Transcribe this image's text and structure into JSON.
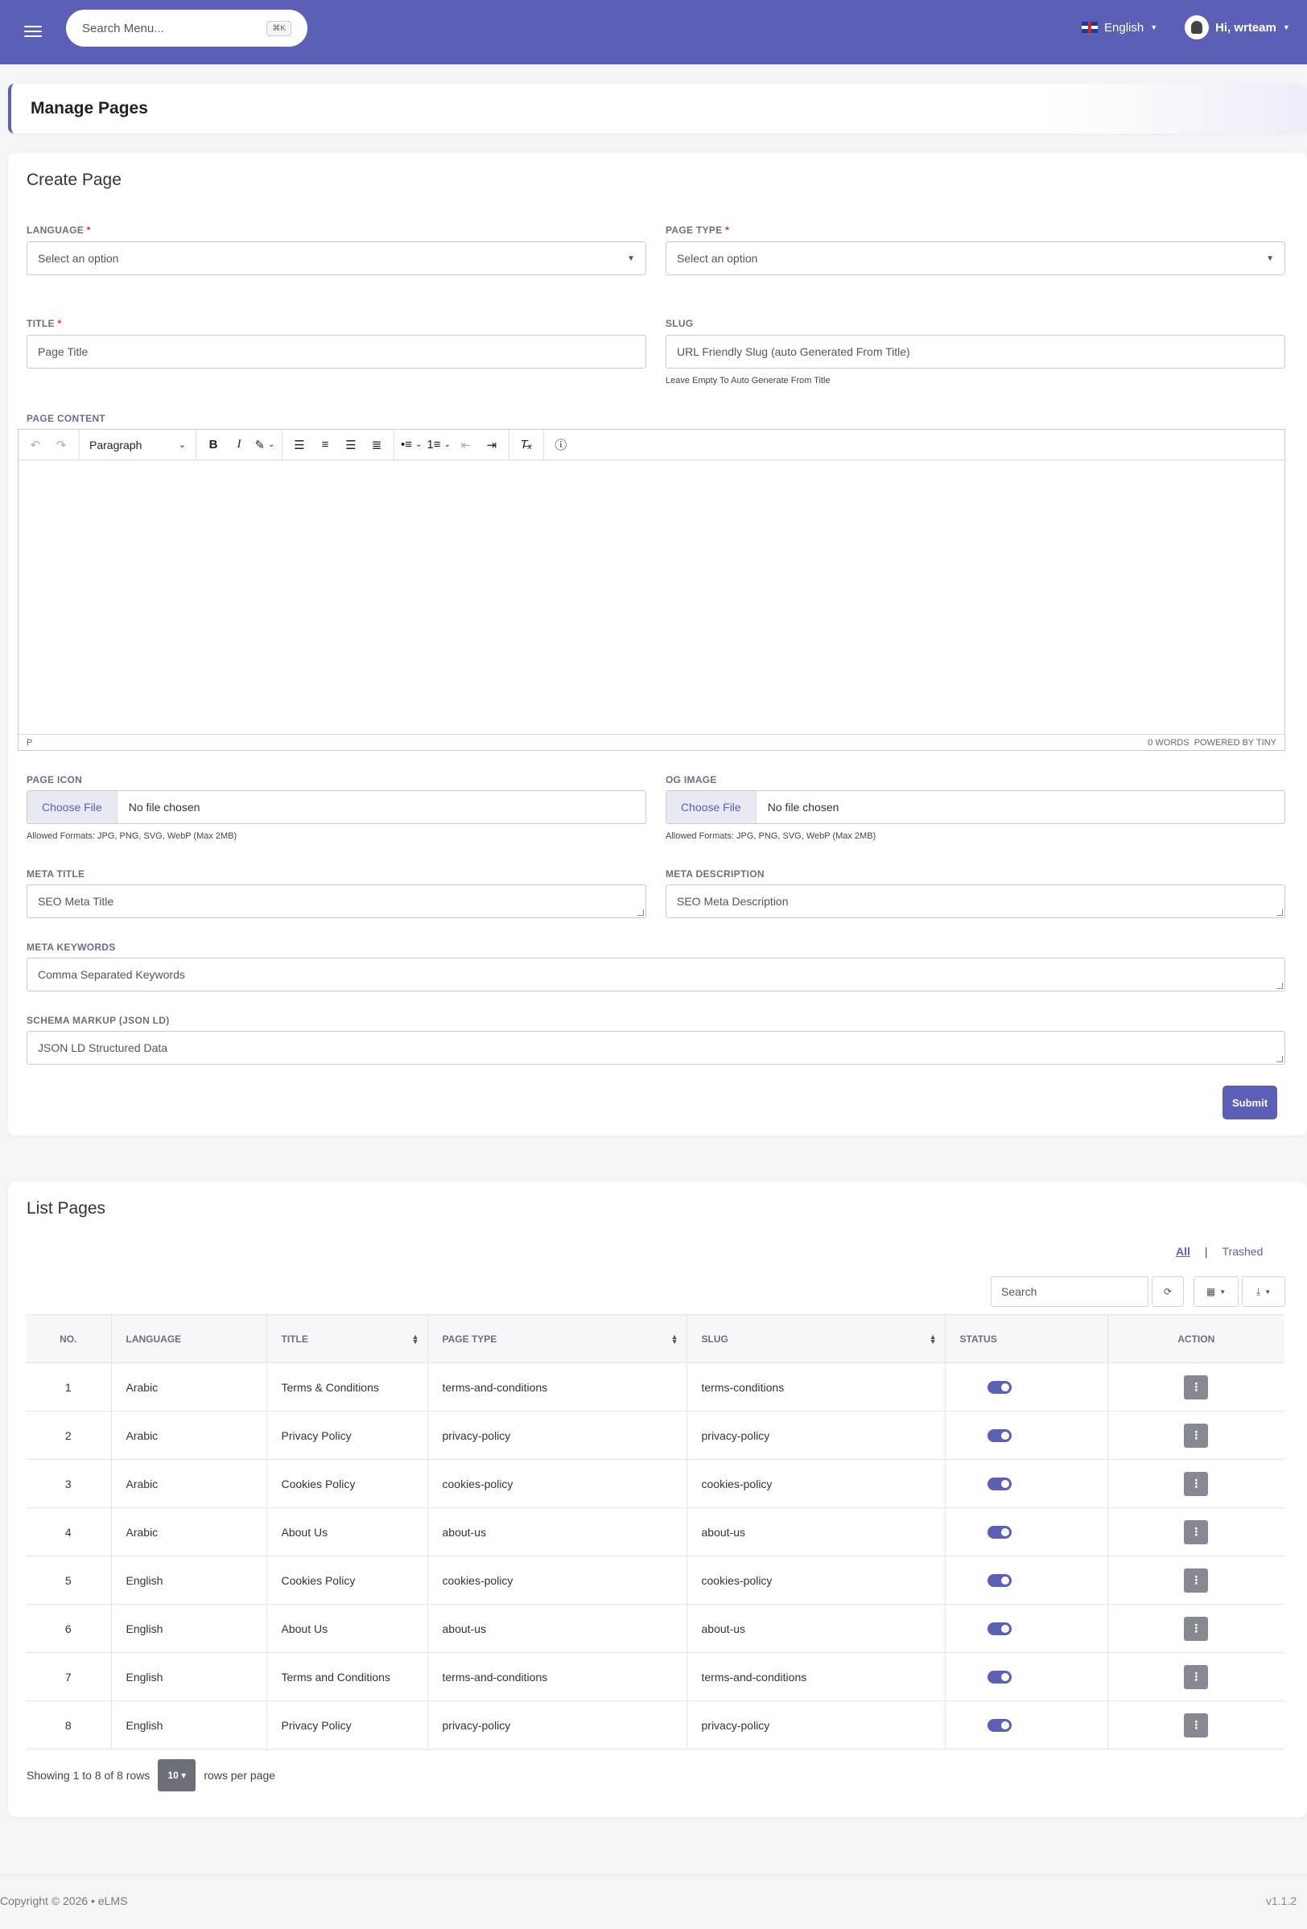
{
  "topbar": {
    "search_placeholder": "Search Menu...",
    "search_shortcut": "⌘K",
    "language": "English",
    "user_greeting": "Hi, wrteam"
  },
  "page": {
    "title": "Manage Pages"
  },
  "create_form": {
    "title": "Create Page",
    "language": {
      "label": "LANGUAGE",
      "value": "Select an option"
    },
    "page_type": {
      "label": "PAGE TYPE",
      "value": "Select an option"
    },
    "title_field": {
      "label": "TITLE",
      "placeholder": "Page Title"
    },
    "slug": {
      "label": "SLUG",
      "placeholder": "URL Friendly Slug (auto Generated From Title)",
      "hint": "Leave Empty To Auto Generate From Title"
    },
    "content": {
      "label": "PAGE CONTENT",
      "block_format": "Paragraph",
      "status_path": "P",
      "status_words": "0 WORDS",
      "status_powered": "POWERED BY TINY"
    },
    "page_icon": {
      "label": "PAGE ICON",
      "button": "Choose File",
      "status": "No file chosen",
      "hint": "Allowed Formats: JPG, PNG, SVG, WebP (Max 2MB)"
    },
    "og_image": {
      "label": "OG IMAGE",
      "button": "Choose File",
      "status": "No file chosen",
      "hint": "Allowed Formats: JPG, PNG, SVG, WebP (Max 2MB)"
    },
    "meta_title": {
      "label": "META TITLE",
      "placeholder": "SEO Meta Title"
    },
    "meta_description": {
      "label": "META DESCRIPTION",
      "placeholder": "SEO Meta Description"
    },
    "meta_keywords": {
      "label": "META KEYWORDS",
      "placeholder": "Comma Separated Keywords"
    },
    "schema_markup": {
      "label": "SCHEMA MARKUP (JSON LD)",
      "placeholder": "JSON LD Structured Data"
    },
    "submit": "Submit"
  },
  "list": {
    "title": "List Pages",
    "filter_all": "All",
    "filter_separator": "|",
    "filter_trashed": "Trashed",
    "search_placeholder": "Search",
    "columns": [
      "NO.",
      "LANGUAGE",
      "TITLE",
      "PAGE TYPE",
      "SLUG",
      "STATUS",
      "ACTION"
    ],
    "rows": [
      {
        "no": "1",
        "language": "Arabic",
        "title": "Terms & Conditions",
        "page_type": "terms-and-conditions",
        "slug": "terms-conditions",
        "status": true
      },
      {
        "no": "2",
        "language": "Arabic",
        "title": "Privacy Policy",
        "page_type": "privacy-policy",
        "slug": "privacy-policy",
        "status": true
      },
      {
        "no": "3",
        "language": "Arabic",
        "title": "Cookies Policy",
        "page_type": "cookies-policy",
        "slug": "cookies-policy",
        "status": true
      },
      {
        "no": "4",
        "language": "Arabic",
        "title": "About Us",
        "page_type": "about-us",
        "slug": "about-us",
        "status": true
      },
      {
        "no": "5",
        "language": "English",
        "title": "Cookies Policy",
        "page_type": "cookies-policy",
        "slug": "cookies-policy",
        "status": true
      },
      {
        "no": "6",
        "language": "English",
        "title": "About Us",
        "page_type": "about-us",
        "slug": "about-us",
        "status": true
      },
      {
        "no": "7",
        "language": "English",
        "title": "Terms and Conditions",
        "page_type": "terms-and-conditions",
        "slug": "terms-and-conditions",
        "status": true
      },
      {
        "no": "8",
        "language": "English",
        "title": "Privacy Policy",
        "page_type": "privacy-policy",
        "slug": "privacy-policy",
        "status": true
      }
    ],
    "pagination_info": "Showing 1 to 8 of 8 rows",
    "page_size": "10",
    "page_size_suffix": "rows per page"
  },
  "footer": {
    "copyright": "Copyright © 2026  •  eLMS",
    "version": "v1.1.2"
  },
  "colors": {
    "primary": "#5b5fb5",
    "required": "#e0301e"
  }
}
